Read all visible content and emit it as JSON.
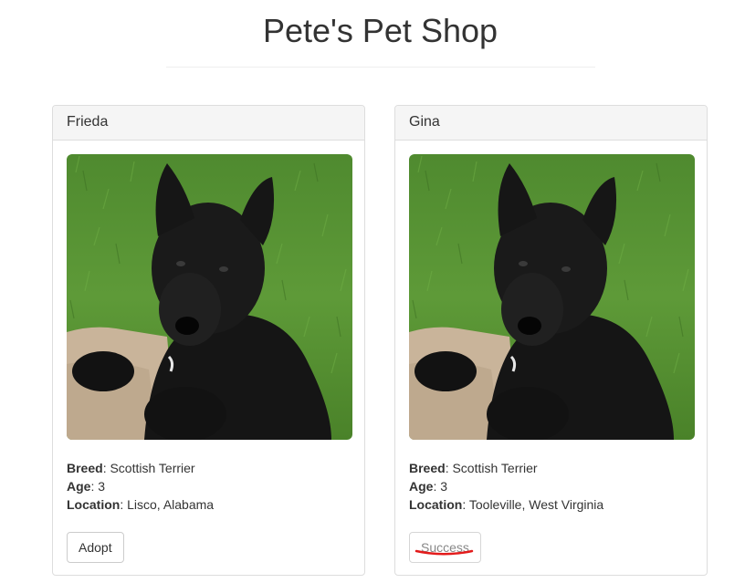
{
  "header": {
    "title": "Pete's Pet Shop"
  },
  "pets": [
    {
      "name": "Frieda",
      "breed_label": "Breed",
      "breed": "Scottish Terrier",
      "age_label": "Age",
      "age": "3",
      "location_label": "Location",
      "location": "Lisco, Alabama",
      "button_label": "Adopt",
      "button_state": "enabled"
    },
    {
      "name": "Gina",
      "breed_label": "Breed",
      "breed": "Scottish Terrier",
      "age_label": "Age",
      "age": "3",
      "location_label": "Location",
      "location": "Tooleville, West Virginia",
      "button_label": "Success",
      "button_state": "disabled"
    }
  ],
  "colors": {
    "panel_heading_bg": "#f5f5f5",
    "panel_border": "#dddddd",
    "annotation_underline": "#e31b1b"
  },
  "icons": {
    "pet_photo": "scottish-terrier-photo",
    "annotation": "red-underline-mark"
  }
}
